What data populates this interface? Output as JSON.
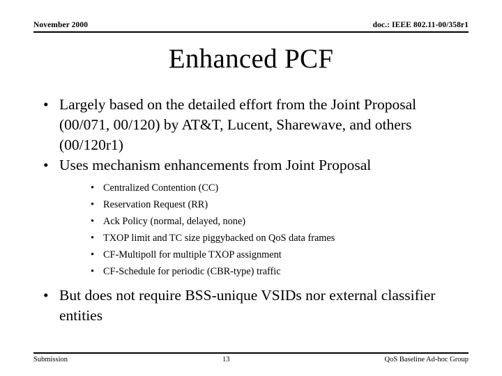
{
  "slide": {
    "header": {
      "date": "November 2000",
      "document_id": "doc.: IEEE 802.11-00/358r1"
    },
    "title": "Enhanced PCF",
    "bullets": [
      {
        "level": 1,
        "marker": "•",
        "text": "Largely based on the detailed effort from the Joint Proposal (00/071, 00/120) by AT&T, Lucent, Sharewave, and others (00/120r1)"
      },
      {
        "level": 1,
        "marker": "•",
        "text": "Uses mechanism enhancements from Joint Proposal"
      },
      {
        "level": 1,
        "marker": "•",
        "text": "But does not require BSS-unique VSIDs nor external classifier entities"
      }
    ],
    "sub_bullets": [
      {
        "marker": "•",
        "text": "Centralized Contention (CC)"
      },
      {
        "marker": "•",
        "text": "Reservation Request (RR)"
      },
      {
        "marker": "•",
        "text": "Ack Policy (normal, delayed, none)"
      },
      {
        "marker": "•",
        "text": "TXOP limit and TC size piggybacked on QoS data frames"
      },
      {
        "marker": "•",
        "text": "CF-Multipoll for multiple TXOP assignment"
      },
      {
        "marker": "•",
        "text": "CF-Schedule for periodic (CBR-type) traffic"
      }
    ],
    "footer": {
      "left": "Submission",
      "page_number": "13",
      "right": "QoS Baseline Ad-hoc Group"
    },
    "colors": {
      "text": "#000000",
      "background": "#ffffff",
      "rule": "#000000"
    }
  }
}
